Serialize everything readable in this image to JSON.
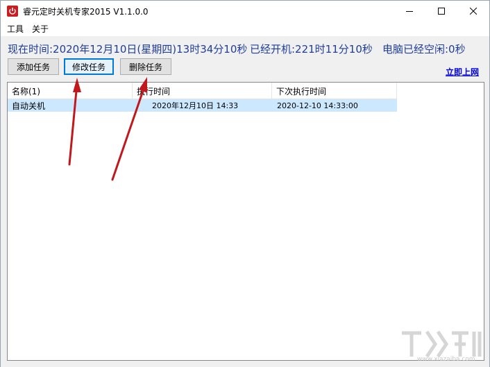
{
  "window": {
    "title": "睿元定时关机专家2015 V1.1.0.0"
  },
  "menu": {
    "tools": "工具",
    "about": "关于"
  },
  "status": {
    "now": "现在时间:2020年12月10日(星期四)13时34分10秒",
    "uptime": "已经开机:221时11分10秒",
    "idle": "电脑已经空闲:0秒"
  },
  "buttons": {
    "add": "添加任务",
    "edit": "修改任务",
    "delete": "删除任务"
  },
  "link": {
    "online": "立即上网"
  },
  "table": {
    "columns": [
      "名称(1)",
      "执行时间",
      "下次执行时间"
    ],
    "rows": [
      {
        "name": "自动关机",
        "exec_time": "2020年12月10日 14:33",
        "next_time": "2020-12-10 14:33:00"
      }
    ]
  },
  "watermark": {
    "text": "www.xiazaiba.com"
  },
  "colors": {
    "status_text": "#1f3d99",
    "selected_row": "#cce8ff",
    "arrow": "#c0181c",
    "app_icon": "#c91d22"
  }
}
